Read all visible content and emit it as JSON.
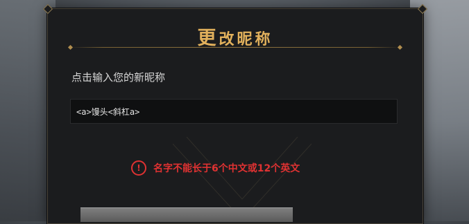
{
  "dialog": {
    "title_first": "更",
    "title_rest": "改昵称",
    "prompt": "点击输入您的新昵称",
    "name_value": "<a>馒头<斜杠a>",
    "error_message": "名字不能长于6个中文或12个英文",
    "error_icon_glyph": "!"
  },
  "colors": {
    "title_gold": "#e2b15c",
    "error_red": "#e03232",
    "panel_bg": "#1b1c1e"
  }
}
